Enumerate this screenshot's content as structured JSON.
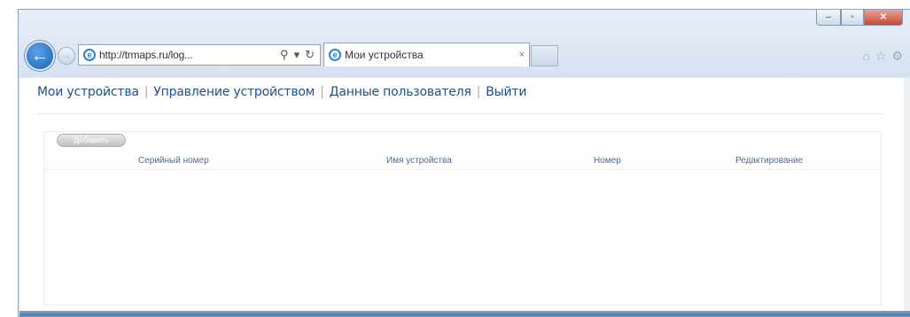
{
  "browser": {
    "address_url": "http://trmaps.ru/log...",
    "address_tools": [
      "⚲",
      "▾",
      "↻"
    ],
    "tab_title": "Мои устройства",
    "tab_close": "×",
    "window_controls": {
      "minimize": "–",
      "maximize": "▫",
      "close": "✕"
    },
    "right_tools": [
      "⌂",
      "☆",
      "⚙"
    ]
  },
  "nav": {
    "items": [
      "Мои устройства",
      "Управление устройством",
      "Данные пользователя",
      "Выйти"
    ],
    "separators": [
      "|",
      "|",
      "|"
    ]
  },
  "panel": {
    "add_button_label": "Добавить",
    "columns": [
      "Серийный номер",
      "Имя устройства",
      "Номер",
      "Редактирование"
    ]
  },
  "colors": {
    "nav_link": "#1f4f8a",
    "header_text": "#4b6c99",
    "frame": "#dfe8f3"
  }
}
